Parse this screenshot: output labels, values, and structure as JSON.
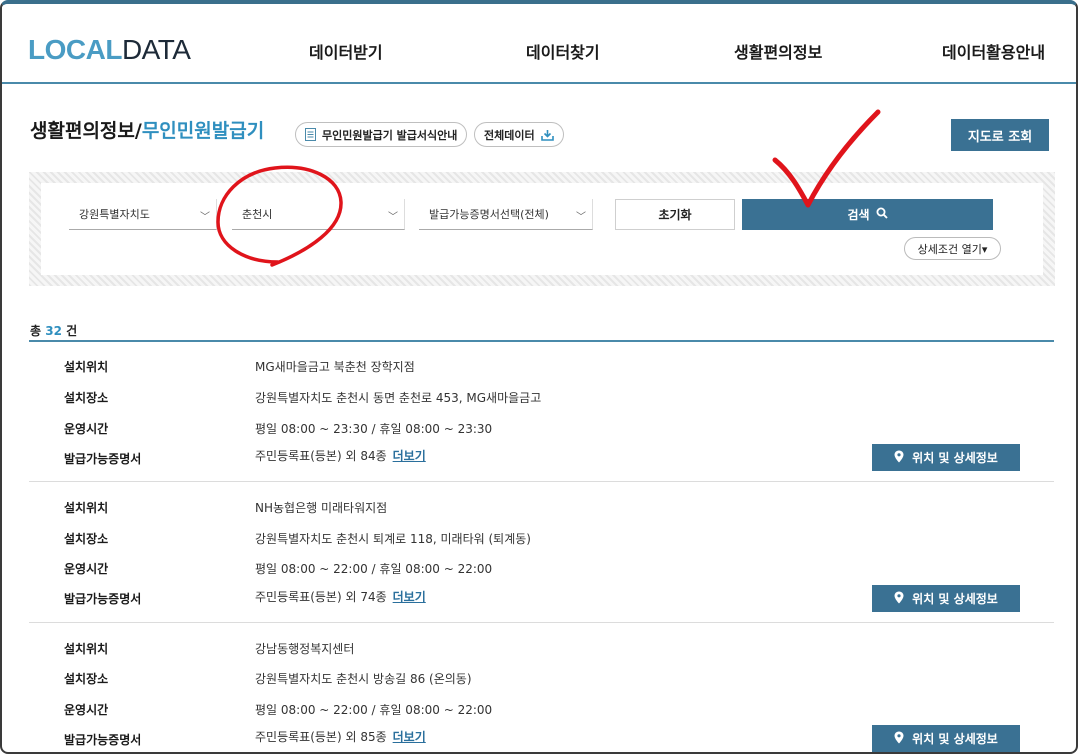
{
  "header": {
    "logo_part1": "LOCAL",
    "logo_part2": "DATA",
    "nav": [
      "데이터받기",
      "데이터찾기",
      "생활편의정보",
      "데이터활용안내"
    ]
  },
  "page": {
    "title_main": "생활편의정보/",
    "title_accent": "무인민원발급기",
    "guide_pill": "무인민원발급기 발급서식안내",
    "all_data_pill": "전체데이터",
    "map_button": "지도로 조회"
  },
  "search": {
    "region_select": "강원특별자치도",
    "city_select": "춘천시",
    "cert_select": "발급가능증명서선택(전체)",
    "reset_label": "초기화",
    "search_label": "검색",
    "detail_toggle": "상세조건 열기▾"
  },
  "summary": {
    "prefix": "총",
    "count": "32",
    "suffix": "건"
  },
  "labels": {
    "location": "설치위치",
    "place": "설치장소",
    "hours": "운영시간",
    "certs": "발급가능증명서",
    "more": "더보기",
    "detail_button": "위치 및 상세정보"
  },
  "results": [
    {
      "location": "MG새마을금고 북춘천 장학지점",
      "place": "강원특별자치도 춘천시 동면 춘천로 453, MG새마을금고",
      "hours": "평일 08:00 ~ 23:30 / 휴일 08:00 ~ 23:30",
      "certs": "주민등록표(등본) 외 84종"
    },
    {
      "location": "NH농협은행 미래타워지점",
      "place": "강원특별자치도 춘천시 퇴계로 118, 미래타워 (퇴계동)",
      "hours": "평일 08:00 ~ 22:00 / 휴일 08:00 ~ 22:00",
      "certs": "주민등록표(등본) 외 74종"
    },
    {
      "location": "강남동행정복지센터",
      "place": "강원특별자치도 춘천시 방송길 86 (온의동)",
      "hours": "평일 08:00 ~ 22:00 / 휴일 08:00 ~ 22:00",
      "certs": "주민등록표(등본) 외 85종"
    }
  ],
  "colors": {
    "accent": "#2f8fbf",
    "button": "#3a7193",
    "annotation": "#e0141b"
  }
}
